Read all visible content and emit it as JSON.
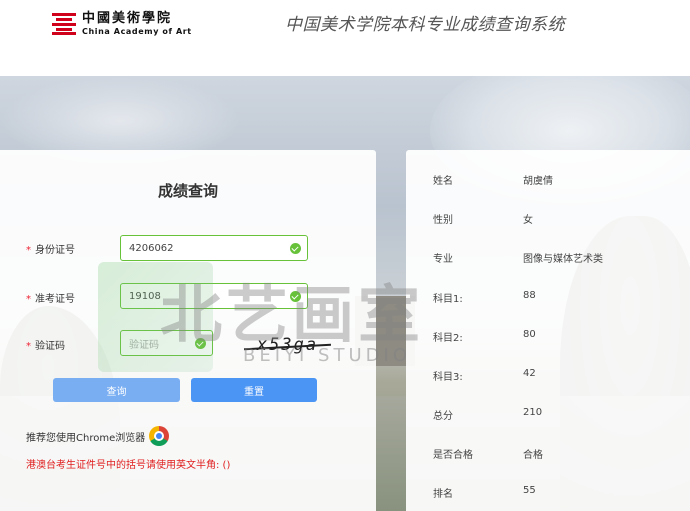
{
  "header": {
    "logo_cn": "中國美術學院",
    "logo_en": "China Academy of Art",
    "system_title": "中国美术学院本科专业成绩查询系统"
  },
  "form": {
    "title": "成绩查询",
    "id_label": "身份证号",
    "id_value": "4206062",
    "exam_label": "准考证号",
    "exam_value": "19108",
    "captcha_label": "验证码",
    "captcha_placeholder": "验证码",
    "captcha_text": "x53ga",
    "query_button": "查询",
    "reset_button": "重置",
    "browser_tip": "推荐您使用Chrome浏览器",
    "hk_tip": "港澳台考生证件号中的括号请使用英文半角: ()"
  },
  "result": {
    "rows": [
      {
        "key": "姓名",
        "value": "胡虞倩"
      },
      {
        "key": "性别",
        "value": "女"
      },
      {
        "key": "专业",
        "value": "图像与媒体艺术类"
      },
      {
        "key": "科目1:",
        "value": "88"
      },
      {
        "key": "科目2:",
        "value": "80"
      },
      {
        "key": "科目3:",
        "value": "42"
      },
      {
        "key": "总分",
        "value": "210"
      },
      {
        "key": "是否合格",
        "value": "合格"
      },
      {
        "key": "排名",
        "value": "55"
      }
    ]
  },
  "watermark": {
    "cn": "北艺画室",
    "en": "BEIYI STUDIO"
  },
  "colors": {
    "brand_red": "#d0021b",
    "valid_green": "#67c23a",
    "button_blue": "#4b95f5",
    "warning_red": "#e02020"
  },
  "icons": [
    "logo-mark-icon",
    "check-icon",
    "chrome-icon"
  ]
}
